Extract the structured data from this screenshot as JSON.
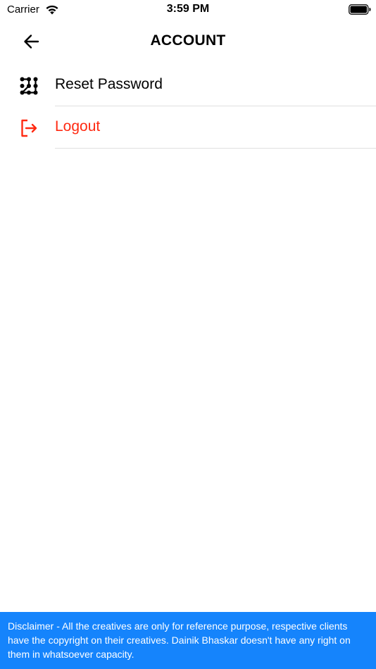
{
  "status_bar": {
    "carrier": "Carrier",
    "time": "3:59 PM"
  },
  "header": {
    "title": "ACCOUNT",
    "back_icon": "arrow-left-icon"
  },
  "menu": {
    "items": [
      {
        "label": "Reset Password",
        "icon": "pattern-lock-icon",
        "color": "#000000"
      },
      {
        "label": "Logout",
        "icon": "logout-icon",
        "color": "#ff2a12"
      }
    ]
  },
  "disclaimer": {
    "text": "Disclaimer - All the creatives are only for reference purpose, respective clients have the copyright on their creatives. Dainik Bhaskar doesn't have any right on them in whatsoever capacity.",
    "background": "#1584fc"
  }
}
